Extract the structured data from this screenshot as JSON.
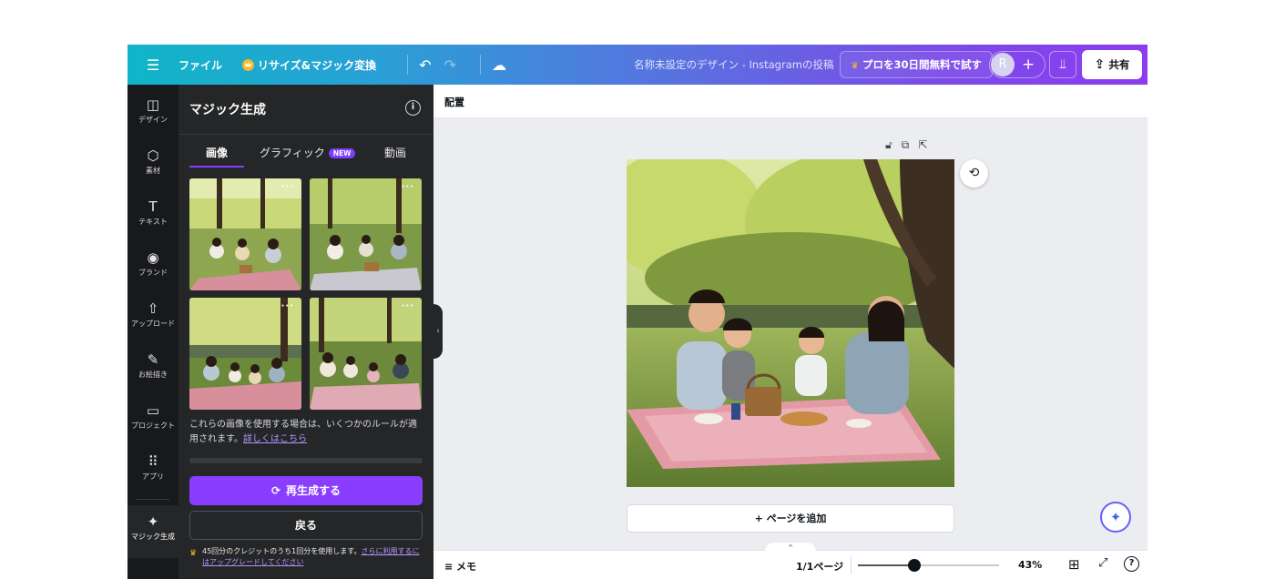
{
  "topbar": {
    "menu_icon": "hamburger-icon",
    "file": "ファイル",
    "resize": "リサイズ&マジック変換",
    "doc_title": "名称未設定のデザイン - Instagramの投稿",
    "pro_trial": "プロを30日間無料で試す",
    "avatar": "R",
    "plus": "+",
    "share": "共有"
  },
  "rail": {
    "items": [
      {
        "icon": "design-icon",
        "glyph": "◫",
        "label": "デザイン"
      },
      {
        "icon": "elements-icon",
        "glyph": "⬡",
        "label": "素材"
      },
      {
        "icon": "text-icon",
        "glyph": "T",
        "label": "テキスト"
      },
      {
        "icon": "brand-icon",
        "glyph": "◉",
        "label": "ブランド"
      },
      {
        "icon": "upload-icon",
        "glyph": "⇧",
        "label": "アップロード"
      },
      {
        "icon": "draw-icon",
        "glyph": "✎",
        "label": "お絵描き"
      },
      {
        "icon": "projects-icon",
        "glyph": "▭",
        "label": "プロジェクト"
      },
      {
        "icon": "apps-icon",
        "glyph": "⠿",
        "label": "アプリ"
      },
      {
        "icon": "magic-gen-icon",
        "glyph": "✦",
        "label": "マジック生成"
      }
    ]
  },
  "panel": {
    "title": "マジック生成",
    "tabs": [
      "画像",
      "グラフィック",
      "動画"
    ],
    "new_badge": "NEW",
    "rules_text": "これらの画像を使用する場合は、いくつかのルールが適用されます。",
    "rules_link": "詳しくはこちら",
    "regenerate": "再生成する",
    "back": "戻る",
    "credits_text": "45回分のクレジットのうち1回分を使用します。",
    "credits_link": "さらに利用するにはアップグレードしてください"
  },
  "canvas": {
    "context_label": "配置",
    "add_page": "+ ページを追加"
  },
  "footer": {
    "notes": "メモ",
    "page_indicator": "1/1ページ",
    "zoom": "43%",
    "zoom_fraction": 0.4
  },
  "colors": {
    "accent": "#8b3dff",
    "panel_bg": "#252627",
    "rail_bg": "#18191b"
  }
}
